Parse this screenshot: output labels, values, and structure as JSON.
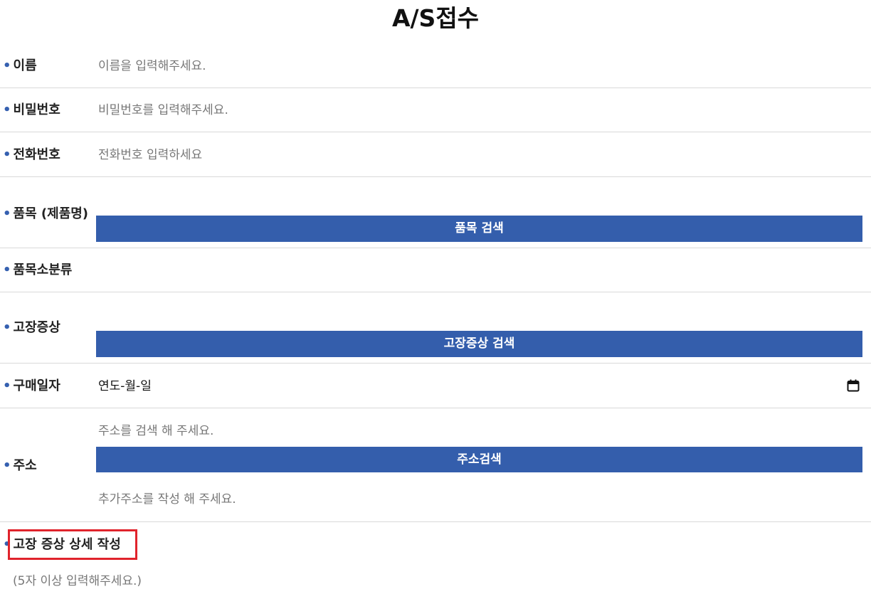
{
  "page": {
    "title": "A/S접수"
  },
  "form": {
    "bullet": "•",
    "name": {
      "label": "이름",
      "placeholder": "이름을 입력해주세요."
    },
    "password": {
      "label": "비밀번호",
      "placeholder": "비밀번호를 입력해주세요."
    },
    "phone": {
      "label": "전화번호",
      "placeholder": "전화번호 입력하세요"
    },
    "product": {
      "label": "품목 (제품명)",
      "button": "품목 검색"
    },
    "subcategory": {
      "label": "품목소분류"
    },
    "symptom": {
      "label": "고장증상",
      "button": "고장증상 검색"
    },
    "purchase_date": {
      "label": "구매일자",
      "value": "연도-월-일",
      "icon": "calendar-icon"
    },
    "address": {
      "label": "주소",
      "placeholder": "주소를 검색 해 주세요.",
      "button": "주소검색",
      "extra_placeholder": "추가주소를 작성 해 주세요."
    },
    "detail": {
      "label": "고장 증상 상세 작성",
      "hint": "(5자 이상 입력해주세요.)"
    }
  },
  "colors": {
    "button_bg": "#345eac",
    "bullet": "#3560b0",
    "highlight": "#e0232c",
    "divider": "#d9d9d9"
  }
}
